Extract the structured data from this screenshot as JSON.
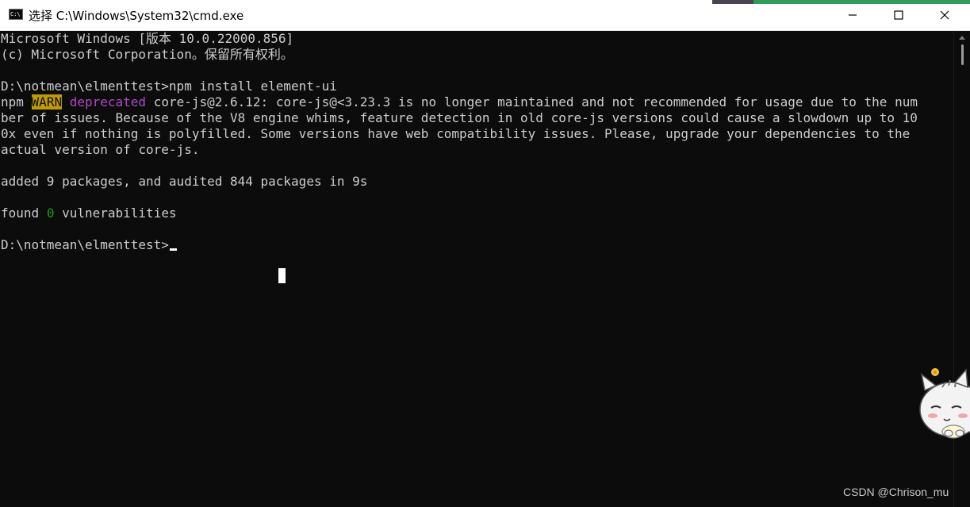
{
  "window": {
    "title": "选择 C:\\Windows\\System32\\cmd.exe",
    "icon": "cmd-icon",
    "controls": [
      "minimize-icon",
      "maximize-icon",
      "close-icon"
    ]
  },
  "colors": {
    "background": "#0c0c0c",
    "foreground": "#cccccc",
    "warn_bg": "#c19c00",
    "deprecated": "#b148c6",
    "count_green": "#13a10e"
  },
  "console": {
    "line1": "Microsoft Windows [版本 10.0.22000.856]",
    "line2": "(c) Microsoft Corporation。保留所有权利。",
    "prompt1": "D:\\notmean\\elmenttest>",
    "command": "npm install element-ui",
    "warn_prefix": "npm",
    "warn_tag": "WARN",
    "warn_kind": "deprecated",
    "warn_msg": "core-js@2.6.12: core-js@<3.23.3 is no longer maintained and not recommended for usage due to the num",
    "warn_cont1": "ber of issues. Because of the V8 engine whims, feature detection in old core-js versions could cause a slowdown up to 10",
    "warn_cont2": "0x even if nothing is polyfilled. Some versions have web compatibility issues. Please, upgrade your dependencies to the",
    "warn_cont3": "actual version of core-js.",
    "added": "added 9 packages, and audited 844 packages in 9s",
    "found_prefix": "found",
    "found_count": "0",
    "found_suffix": "vulnerabilities",
    "prompt2": "D:\\notmean\\elmenttest>"
  },
  "watermark": "CSDN @Chrison_mu"
}
